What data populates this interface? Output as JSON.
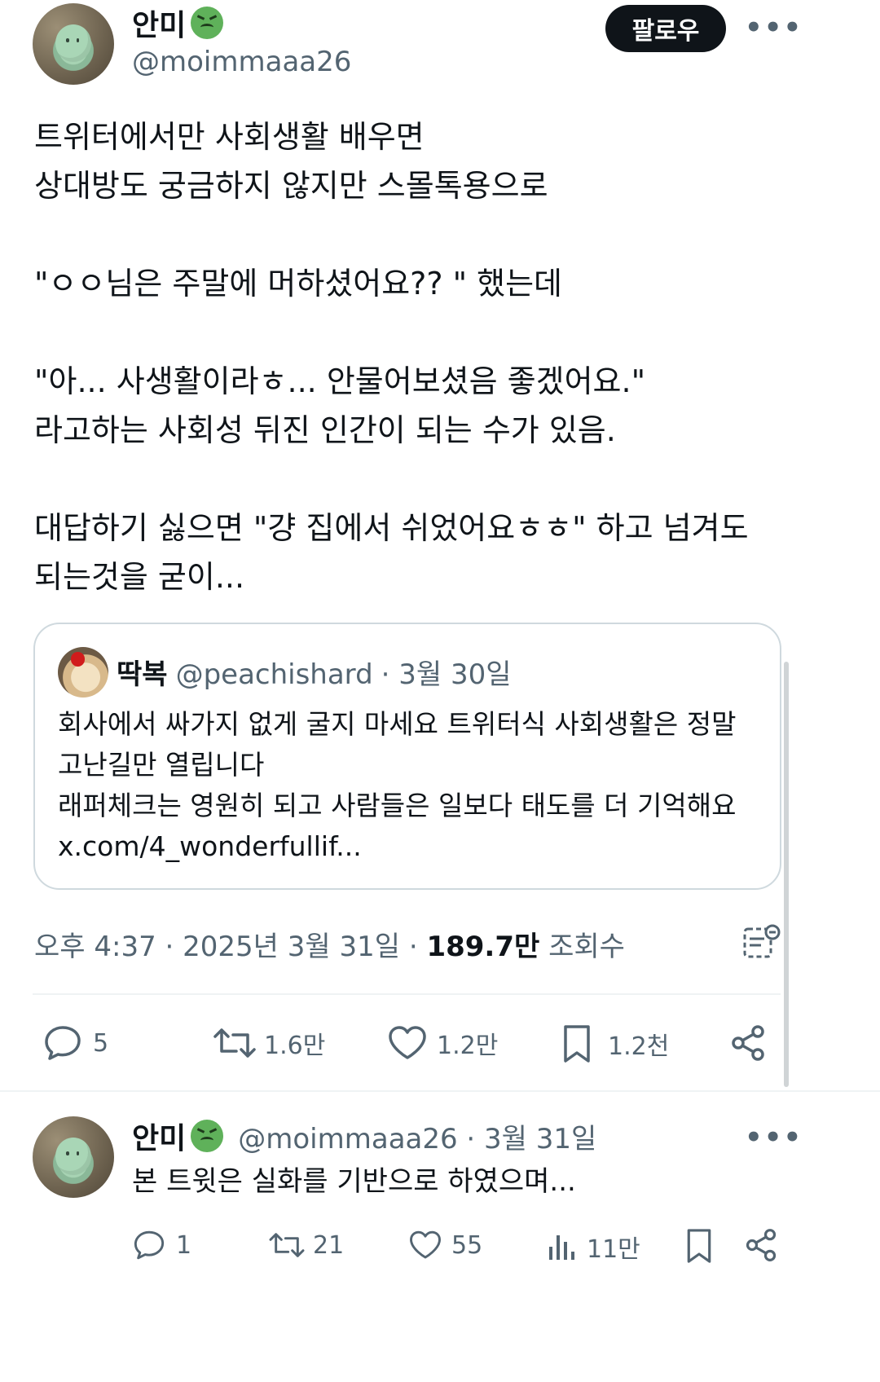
{
  "main_tweet": {
    "author_name": "안미",
    "handle": "@moimmaaa26",
    "follow_label": "팔로우",
    "more_label": "•••",
    "text_lines": [
      "트위터에서만 사회생활 배우면",
      "상대방도 궁금하지 않지만 스몰톡용으로",
      "\"ㅇㅇ님은 주말에 머하셨어요?? \" 했는데",
      "\"아... 사생활이라ㅎ... 안물어보셨음 좋겠어요.\"",
      "라고하는 사회성 뒤진 인간이 되는 수가 있음.",
      "대답하기 싫으면 \"걍 집에서 쉬었어요ㅎㅎ\" 하고 넘겨도",
      "되는것을 굳이..."
    ],
    "quote": {
      "name": "딱복",
      "handle": "@peachishard",
      "date": "· 3월 30일",
      "lines": [
        "회사에서 싸가지 없게 굴지 마세요 트위터식 사회생활은 정말",
        "고난길만 열립니다",
        "래퍼체크는 영원히 되고 사람들은 일보다 태도를 더 기억해요",
        "x.com/4_wonderfullif..."
      ]
    },
    "meta": {
      "time_date": "오후 4:37 · 2025년 3월 31일 · ",
      "views_value": "189.7만",
      "views_label": " 조회수"
    },
    "actions": {
      "replies": "5",
      "retweets": "1.6만",
      "likes": "1.2만",
      "bookmarks": "1.2천"
    }
  },
  "reply_tweet": {
    "author_name": "안미",
    "handle_date": "@moimmaaa26 · 3월 31일",
    "more_label": "•••",
    "text": "본 트윗은 실화를 기반으로 하였으며...",
    "actions": {
      "replies": "1",
      "retweets": "21",
      "likes": "55",
      "views": "11만"
    }
  }
}
